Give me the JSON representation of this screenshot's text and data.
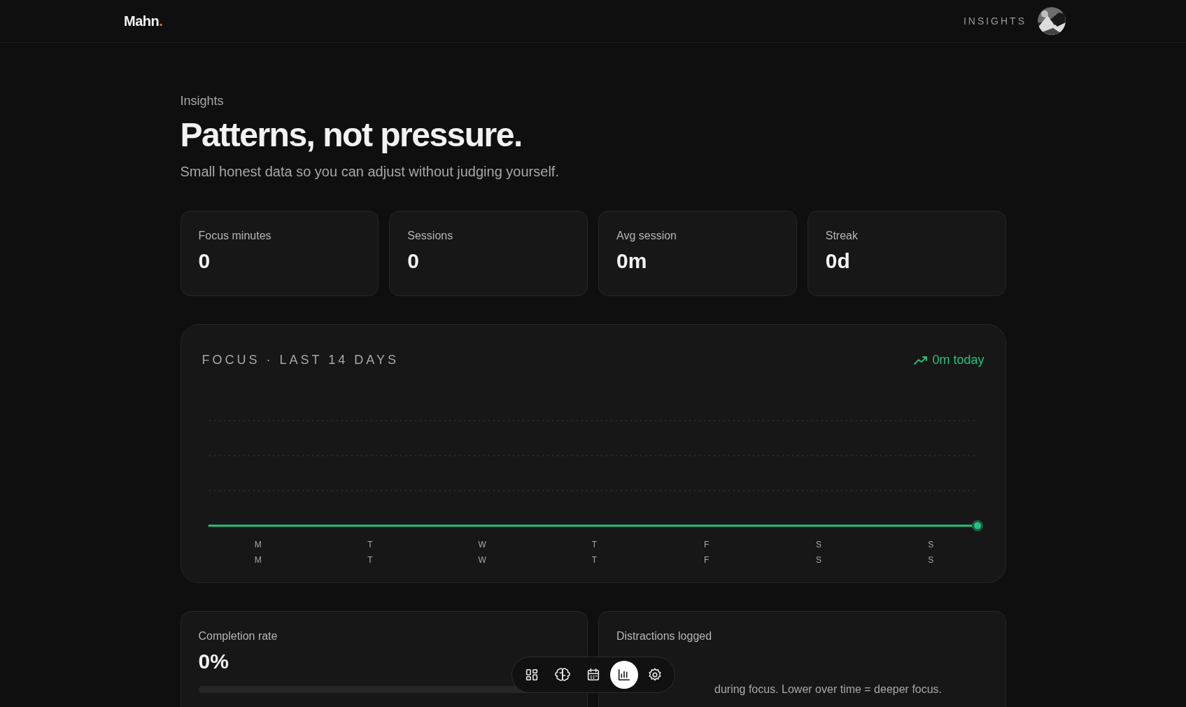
{
  "header": {
    "brand": "Mahn",
    "brand_dot": ".",
    "nav_label": "INSIGHTS"
  },
  "page": {
    "eyebrow": "Insights",
    "title": "Patterns, not pressure.",
    "subtitle": "Small honest data so you can adjust without judging yourself."
  },
  "stats": [
    {
      "label": "Focus minutes",
      "value": "0"
    },
    {
      "label": "Sessions",
      "value": "0"
    },
    {
      "label": "Avg session",
      "value": "0m"
    },
    {
      "label": "Streak",
      "value": "0d"
    }
  ],
  "focus_chart": {
    "title": "FOCUS · LAST 14 DAYS",
    "today": "0m today",
    "day_labels": [
      [
        "M",
        "M"
      ],
      [
        "T",
        "T"
      ],
      [
        "W",
        "W"
      ],
      [
        "T",
        "T"
      ],
      [
        "F",
        "F"
      ],
      [
        "S",
        "S"
      ],
      [
        "S",
        "S"
      ]
    ]
  },
  "completion": {
    "label": "Completion rate",
    "value": "0%",
    "level": 0
  },
  "distractions": {
    "label": "Distractions logged",
    "note": "during focus. Lower over time = deeper focus."
  },
  "bottom_nav": [
    {
      "selected": false
    },
    {
      "selected": false
    },
    {
      "selected": false
    },
    {
      "selected": true
    },
    {
      "selected": false
    }
  ]
}
